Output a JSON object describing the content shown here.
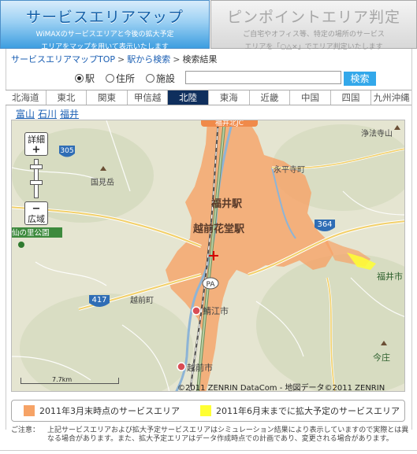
{
  "tabs": {
    "service_map": {
      "title": "サービスエリアマップ",
      "desc_line1": "WiMAXのサービスエリアと今後の拡大予定",
      "desc_line2": "エリアをマップを用いて表示いたします"
    },
    "pinpoint": {
      "title": "ピンポイントエリア判定",
      "desc_line1": "ご自宅やオフィス等、特定の場所のサービス",
      "desc_line2": "エリアを「○△×」でエリア判定いたします"
    }
  },
  "breadcrumb": {
    "top": "サービスエリアマップTOP",
    "search": "駅から検索",
    "current": "検索結果",
    "sep": ">"
  },
  "search": {
    "radio_station": "駅",
    "radio_address": "住所",
    "radio_facility": "施設",
    "input_value": "",
    "button": "検索"
  },
  "regions": [
    "北海道",
    "東北",
    "関東",
    "甲信越",
    "北陸",
    "東海",
    "近畿",
    "中国",
    "四国",
    "九州沖縄"
  ],
  "active_region": "北陸",
  "prefectures": [
    "富山",
    "石川",
    "福井"
  ],
  "map": {
    "zoom_in_label": "詳細",
    "zoom_in_symbol": "+",
    "zoom_out_label": "広域",
    "zoom_out_symbol": "−",
    "scale": "7.7km",
    "copyright": "©2011 ZENRIN DataCom - 地図データ©2011 ZENRIN",
    "labels": {
      "fukui_station": "福井駅",
      "echizen_station": "越前花堂駅",
      "kokumi": "国見岳",
      "eiheiji": "永平寺町",
      "joken": "浄法寺山",
      "echizen_cho": "越前町",
      "sabae": "鯖江市",
      "echizen_shi": "越前市",
      "fukui_shi": "福井市",
      "imajo": "今庄",
      "park": "仙の里公園",
      "fukui_label_top": "福井北JC"
    },
    "routes": {
      "r417": "417",
      "r364": "364",
      "r305": "305",
      "pa": "PA"
    }
  },
  "legend": {
    "current": "2011年3月末時点のサービスエリア",
    "planned": "2011年6月末までに拡大予定のサービスエリア",
    "current_color": "#f6a366",
    "planned_color": "#ffff33"
  },
  "notice": {
    "label": "ご注意：",
    "text": "上記サービスエリアおよび拡大予定サービスエリアはシミュレーション結果により表示していますので実際とは異なる場合があります。また、拡大予定エリアはデータ作成時点での計画であり、変更される場合があります。"
  }
}
